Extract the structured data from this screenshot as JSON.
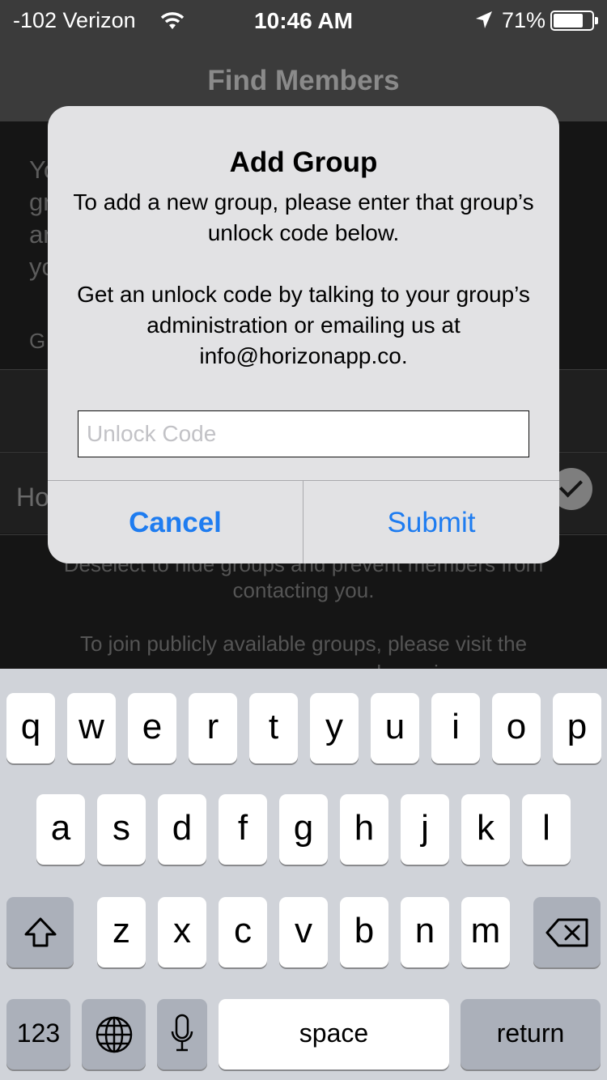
{
  "status_bar": {
    "carrier": "-102 Verizon",
    "time": "10:46 AM",
    "battery_percent": "71%",
    "battery_level": 0.71,
    "icons": [
      "wifi-icon",
      "location-arrow-icon",
      "battery-icon"
    ]
  },
  "nav": {
    "title": "Find Members"
  },
  "background": {
    "desc_lines": [
      "Yo",
      "gr",
      "ar",
      "yo"
    ],
    "groups_header": "G",
    "row_label": "Ho",
    "footer_line1": "Deselect to hide groups and prevent members from",
    "footer_line2": "contacting you.",
    "footer_line3": "To join publicly available groups, please visit the",
    "footer_line4": "groups screen on our web version"
  },
  "alert": {
    "title": "Add Group",
    "message": "To add a new group, please enter that group’s unlock code below.\n\nGet an unlock code by talking to your group’s administration or emailing us at info@horizonapp.co.",
    "input_placeholder": "Unlock Code",
    "input_value": "",
    "cancel_label": "Cancel",
    "submit_label": "Submit",
    "accent_color": "#1e7cf0"
  },
  "keyboard": {
    "row1": [
      "q",
      "w",
      "e",
      "r",
      "t",
      "y",
      "u",
      "i",
      "o",
      "p"
    ],
    "row2": [
      "a",
      "s",
      "d",
      "f",
      "g",
      "h",
      "j",
      "k",
      "l"
    ],
    "row3": [
      "z",
      "x",
      "c",
      "v",
      "b",
      "n",
      "m"
    ],
    "numbers_label": "123",
    "space_label": "space",
    "return_label": "return",
    "icons": [
      "shift-icon",
      "delete-icon",
      "globe-icon",
      "microphone-icon"
    ]
  }
}
